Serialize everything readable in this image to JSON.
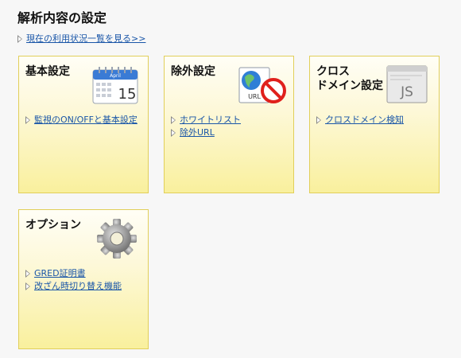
{
  "page": {
    "title": "解析内容の設定",
    "status_link": "現在の利用状況一覧を見る>>"
  },
  "cards": [
    {
      "title": "基本設定",
      "icon": "calendar-icon",
      "icon_text": {
        "month": "April",
        "day": "15"
      },
      "links": [
        "監視のON/OFFと基本設定"
      ]
    },
    {
      "title": "除外設定",
      "icon": "url-block-icon",
      "icon_text": {
        "label": "URL"
      },
      "links": [
        "ホワイトリスト",
        "除外URL"
      ]
    },
    {
      "title": "クロス\nドメイン設定",
      "icon": "js-file-icon",
      "icon_text": {
        "label": "JS"
      },
      "links": [
        "クロスドメイン検知"
      ]
    },
    {
      "title": "オプション",
      "icon": "gear-icon",
      "links": [
        "GRED証明書",
        "改ざん時切り替え機能"
      ]
    }
  ],
  "colors": {
    "link": "#1a56a8",
    "card_border": "#e1cf5a",
    "card_bottom": "#f9f09d"
  }
}
